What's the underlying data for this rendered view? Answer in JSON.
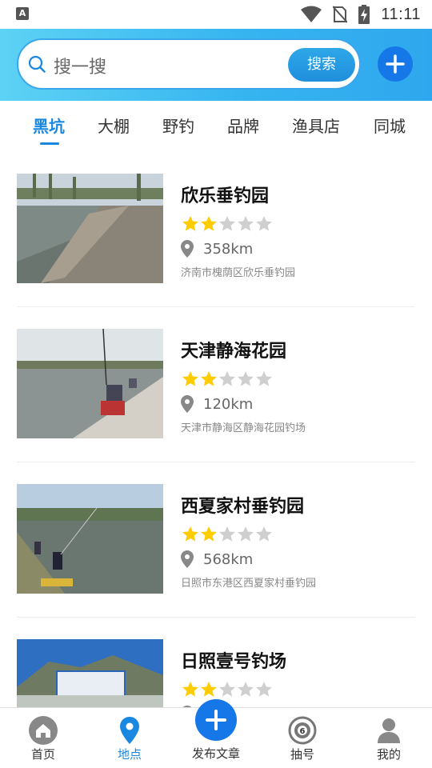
{
  "status_bar": {
    "time": "11:11",
    "left_badge": "A"
  },
  "search": {
    "placeholder": "搜一搜",
    "button_label": "搜索"
  },
  "tabs": [
    {
      "label": "黑坑",
      "active": true
    },
    {
      "label": "大棚",
      "active": false
    },
    {
      "label": "野钓",
      "active": false
    },
    {
      "label": "品牌",
      "active": false
    },
    {
      "label": "渔具店",
      "active": false
    },
    {
      "label": "同城",
      "active": false
    }
  ],
  "spots": [
    {
      "name": "欣乐垂钓园",
      "rating": 2,
      "max_rating": 5,
      "distance": "358km",
      "address": "济南市槐荫区欣乐垂钓园"
    },
    {
      "name": "天津静海花园",
      "rating": 2,
      "max_rating": 5,
      "distance": "120km",
      "address": "天津市静海区静海花园钓场"
    },
    {
      "name": "西夏家村垂钓园",
      "rating": 2,
      "max_rating": 5,
      "distance": "568km",
      "address": "日照市东港区西夏家村垂钓园"
    },
    {
      "name": "日照壹号钓场",
      "rating": 2,
      "max_rating": 5,
      "distance": "",
      "address": ""
    }
  ],
  "bottom_nav": [
    {
      "label": "首页",
      "icon": "home-icon",
      "active": false
    },
    {
      "label": "地点",
      "icon": "location-pin-icon",
      "active": true
    },
    {
      "label": "发布文章",
      "icon": "plus-icon",
      "active": false
    },
    {
      "label": "抽号",
      "icon": "number-ball-icon",
      "active": false
    },
    {
      "label": "我的",
      "icon": "user-icon",
      "active": false
    }
  ],
  "colors": {
    "accent": "#1a88e0",
    "star_on": "#ffcc00",
    "star_off": "#cfcfcf",
    "header_start": "#5dd2f4",
    "header_end": "#2fa7ee"
  }
}
